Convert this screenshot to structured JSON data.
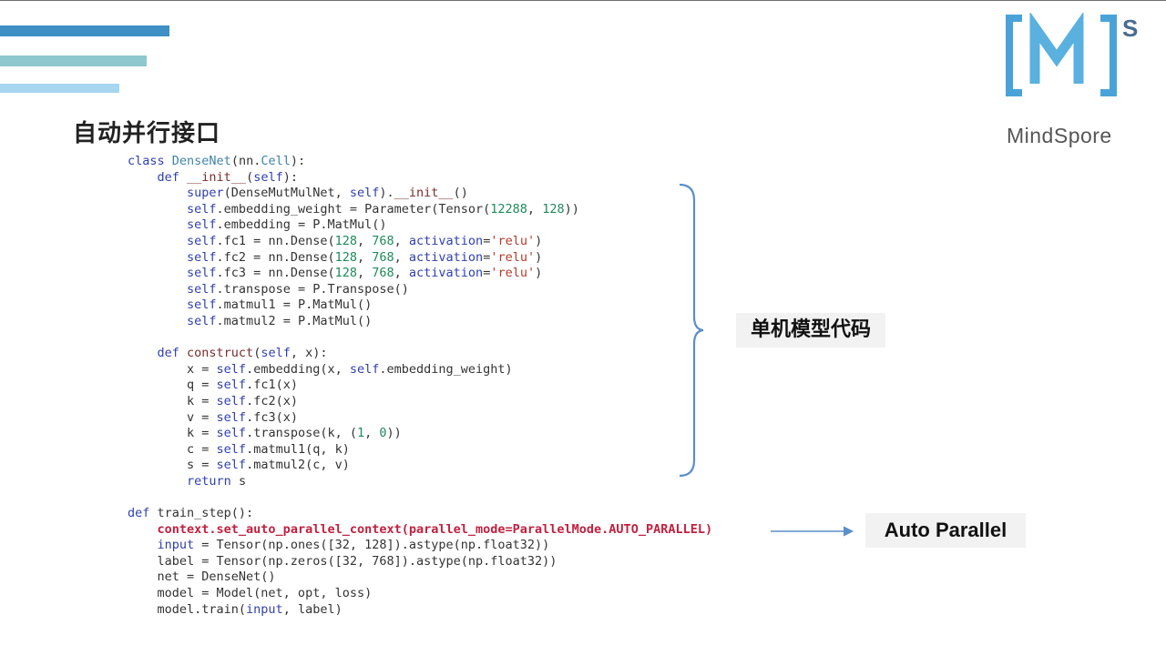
{
  "slide": {
    "title": "自动并行接口",
    "logo": {
      "text": "MindSpore",
      "mark": "[M]",
      "superscript": "S"
    },
    "labels": {
      "single_model": "单机模型代码",
      "auto_parallel": "Auto Parallel"
    },
    "colors": {
      "bar1": "#3d8fc4",
      "bar2": "#8ec7cd",
      "bar3": "#a6d6f0",
      "logo": "#5aa9d6",
      "brace": "#5b8fc8",
      "highlight": "#c21f3e"
    }
  },
  "code": [
    [
      {
        "t": "class ",
        "c": "kw"
      },
      {
        "t": "DenseNet",
        "c": "cls"
      },
      {
        "t": "(nn."
      },
      {
        "t": "Cell",
        "c": "cls"
      },
      {
        "t": "):"
      }
    ],
    [
      {
        "t": "    "
      },
      {
        "t": "def ",
        "c": "kw"
      },
      {
        "t": "__init__",
        "c": "fn"
      },
      {
        "t": "("
      },
      {
        "t": "self",
        "c": "slf"
      },
      {
        "t": "):"
      }
    ],
    [
      {
        "t": "        "
      },
      {
        "t": "super",
        "c": "kw"
      },
      {
        "t": "(DenseMutMulNet, "
      },
      {
        "t": "self",
        "c": "slf"
      },
      {
        "t": ")."
      },
      {
        "t": "__init__",
        "c": "fn"
      },
      {
        "t": "()"
      }
    ],
    [
      {
        "t": "        "
      },
      {
        "t": "self",
        "c": "slf"
      },
      {
        "t": ".embedding_weight = Parameter(Tensor("
      },
      {
        "t": "12288",
        "c": "num"
      },
      {
        "t": ", "
      },
      {
        "t": "128",
        "c": "num"
      },
      {
        "t": "))"
      }
    ],
    [
      {
        "t": "        "
      },
      {
        "t": "self",
        "c": "slf"
      },
      {
        "t": ".embedding = P.MatMul()"
      }
    ],
    [
      {
        "t": "        "
      },
      {
        "t": "self",
        "c": "slf"
      },
      {
        "t": ".fc1 = nn.Dense("
      },
      {
        "t": "128",
        "c": "num"
      },
      {
        "t": ", "
      },
      {
        "t": "768",
        "c": "num"
      },
      {
        "t": ", "
      },
      {
        "t": "activation",
        "c": "slf"
      },
      {
        "t": "="
      },
      {
        "t": "'relu'",
        "c": "str"
      },
      {
        "t": ")"
      }
    ],
    [
      {
        "t": "        "
      },
      {
        "t": "self",
        "c": "slf"
      },
      {
        "t": ".fc2 = nn.Dense("
      },
      {
        "t": "128",
        "c": "num"
      },
      {
        "t": ", "
      },
      {
        "t": "768",
        "c": "num"
      },
      {
        "t": ", "
      },
      {
        "t": "activation",
        "c": "slf"
      },
      {
        "t": "="
      },
      {
        "t": "'relu'",
        "c": "str"
      },
      {
        "t": ")"
      }
    ],
    [
      {
        "t": "        "
      },
      {
        "t": "self",
        "c": "slf"
      },
      {
        "t": ".fc3 = nn.Dense("
      },
      {
        "t": "128",
        "c": "num"
      },
      {
        "t": ", "
      },
      {
        "t": "768",
        "c": "num"
      },
      {
        "t": ", "
      },
      {
        "t": "activation",
        "c": "slf"
      },
      {
        "t": "="
      },
      {
        "t": "'relu'",
        "c": "str"
      },
      {
        "t": ")"
      }
    ],
    [
      {
        "t": "        "
      },
      {
        "t": "self",
        "c": "slf"
      },
      {
        "t": ".transpose = P.Transpose()"
      }
    ],
    [
      {
        "t": "        "
      },
      {
        "t": "self",
        "c": "slf"
      },
      {
        "t": ".matmul1 = P.MatMul()"
      }
    ],
    [
      {
        "t": "        "
      },
      {
        "t": "self",
        "c": "slf"
      },
      {
        "t": ".matmul2 = P.MatMul()"
      }
    ],
    [
      {
        "t": ""
      }
    ],
    [
      {
        "t": "    "
      },
      {
        "t": "def ",
        "c": "kw"
      },
      {
        "t": "construct",
        "c": "fn"
      },
      {
        "t": "("
      },
      {
        "t": "self",
        "c": "slf"
      },
      {
        "t": ", x):"
      }
    ],
    [
      {
        "t": "        x = "
      },
      {
        "t": "self",
        "c": "slf"
      },
      {
        "t": ".embedding(x, "
      },
      {
        "t": "self",
        "c": "slf"
      },
      {
        "t": ".embedding_weight)"
      }
    ],
    [
      {
        "t": "        q = "
      },
      {
        "t": "self",
        "c": "slf"
      },
      {
        "t": ".fc1(x)"
      }
    ],
    [
      {
        "t": "        k = "
      },
      {
        "t": "self",
        "c": "slf"
      },
      {
        "t": ".fc2(x)"
      }
    ],
    [
      {
        "t": "        v = "
      },
      {
        "t": "self",
        "c": "slf"
      },
      {
        "t": ".fc3(x)"
      }
    ],
    [
      {
        "t": "        k = "
      },
      {
        "t": "self",
        "c": "slf"
      },
      {
        "t": ".transpose(k, ("
      },
      {
        "t": "1",
        "c": "num"
      },
      {
        "t": ", "
      },
      {
        "t": "0",
        "c": "num"
      },
      {
        "t": "))"
      }
    ],
    [
      {
        "t": "        c = "
      },
      {
        "t": "self",
        "c": "slf"
      },
      {
        "t": ".matmul1(q, k)"
      }
    ],
    [
      {
        "t": "        s = "
      },
      {
        "t": "self",
        "c": "slf"
      },
      {
        "t": ".matmul2(c, v)"
      }
    ],
    [
      {
        "t": "        "
      },
      {
        "t": "return",
        "c": "kw"
      },
      {
        "t": " s"
      }
    ],
    [
      {
        "t": ""
      }
    ],
    [
      {
        "t": "def ",
        "c": "kw"
      },
      {
        "t": "train_step():"
      }
    ],
    [
      {
        "t": "    "
      },
      {
        "t": "context.set_auto_parallel_context(parallel_mode=ParallelMode.AUTO_PARALLEL)",
        "c": "hl"
      }
    ],
    [
      {
        "t": "    "
      },
      {
        "t": "input",
        "c": "slf"
      },
      {
        "t": " = Tensor(np.ones([32, 128]).astype(np.float32))"
      }
    ],
    [
      {
        "t": "    label = Tensor(np.zeros([32, 768]).astype(np.float32))"
      }
    ],
    [
      {
        "t": "    net = DenseNet()"
      }
    ],
    [
      {
        "t": "    model = Model(net, opt, loss)"
      }
    ],
    [
      {
        "t": "    model.train("
      },
      {
        "t": "input",
        "c": "slf"
      },
      {
        "t": ", label)"
      }
    ]
  ]
}
